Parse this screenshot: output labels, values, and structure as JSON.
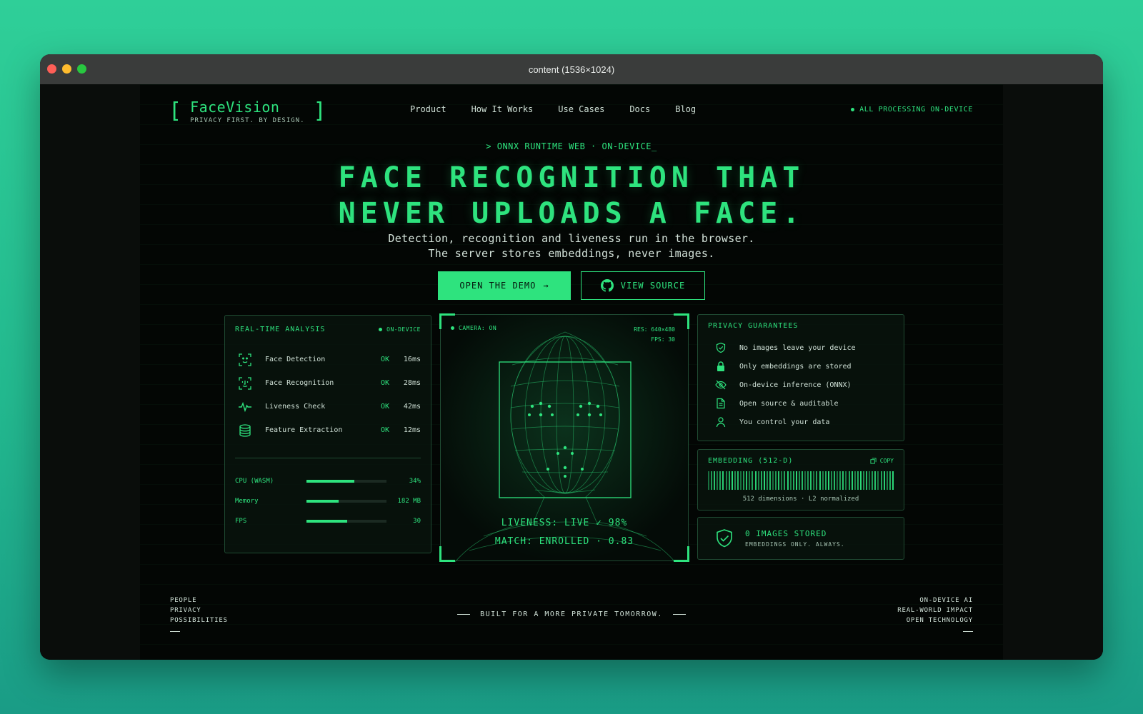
{
  "window": {
    "title": "content (1536×1024)"
  },
  "header": {
    "logo_name": "FaceVision",
    "logo_tagline": "PRIVACY FIRST. BY DESIGN.",
    "nav": [
      "Product",
      "How It Works",
      "Use Cases",
      "Docs",
      "Blog"
    ],
    "status": "ALL PROCESSING ON-DEVICE"
  },
  "hero": {
    "eyebrow": "> ONNX RUNTIME WEB · ON-DEVICE_",
    "headline_line1": "FACE RECOGNITION THAT",
    "headline_line2": "NEVER UPLOADS A FACE.",
    "sub_line1": "Detection, recognition and liveness run in the browser.",
    "sub_line2": "The server stores embeddings, never images.",
    "primary_cta": "OPEN THE DEMO",
    "secondary_cta": "VIEW SOURCE"
  },
  "analysis": {
    "title": "REAL-TIME ANALYSIS",
    "badge": "ON-DEVICE",
    "tasks": [
      {
        "label": "Face Detection",
        "status": "OK",
        "ms": "16ms",
        "icon": "face-scan-icon"
      },
      {
        "label": "Face Recognition",
        "status": "OK",
        "ms": "28ms",
        "icon": "face-id-icon"
      },
      {
        "label": "Liveness Check",
        "status": "OK",
        "ms": "42ms",
        "icon": "pulse-icon"
      },
      {
        "label": "Feature Extraction",
        "status": "OK",
        "ms": "12ms",
        "icon": "database-icon"
      }
    ],
    "metrics": [
      {
        "label": "CPU (WASM)",
        "value": "34%",
        "fill_percent": 60
      },
      {
        "label": "Memory",
        "value": "182 MB",
        "fill_percent": 40
      },
      {
        "label": "FPS",
        "value": "30",
        "fill_percent": 51
      }
    ]
  },
  "camera": {
    "status": "CAMERA: ON",
    "resolution": "RES: 640×480",
    "fps": "FPS: 30",
    "liveness": "LIVENESS: LIVE ✓ 98%",
    "match": "MATCH: ENROLLED · 0.83"
  },
  "privacy": {
    "title": "PRIVACY GUARANTEES",
    "items": [
      {
        "label": "No images leave your device",
        "icon": "shield-check-icon"
      },
      {
        "label": "Only embeddings are stored",
        "icon": "lock-icon"
      },
      {
        "label": "On-device inference (ONNX)",
        "icon": "eye-off-icon"
      },
      {
        "label": "Open source & auditable",
        "icon": "document-icon"
      },
      {
        "label": "You control your data",
        "icon": "user-icon"
      }
    ]
  },
  "embedding": {
    "title": "EMBEDDING (512-D)",
    "copy_label": "COPY",
    "note": "512 dimensions · L2 normalized"
  },
  "stored": {
    "title": "0 IMAGES STORED",
    "subtitle": "EMBEDDINGS ONLY. ALWAYS."
  },
  "footer": {
    "left": [
      "PEOPLE",
      "PRIVACY",
      "POSSIBILITIES"
    ],
    "center": "BUILT FOR A MORE PRIVATE TOMORROW.",
    "right": [
      "ON-DEVICE AI",
      "REAL-WORLD IMPACT",
      "OPEN TECHNOLOGY"
    ]
  },
  "colors": {
    "accent": "#2ee37e",
    "background": "#030604",
    "panel_border": "#1f4a32"
  }
}
